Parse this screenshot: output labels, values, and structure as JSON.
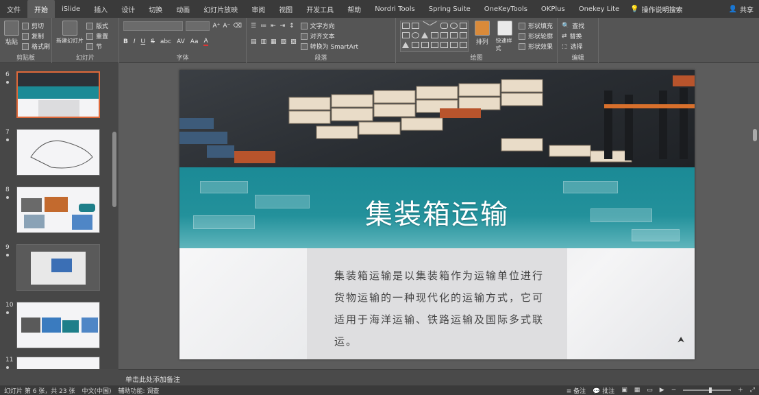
{
  "tabs": [
    "文件",
    "开始",
    "iSlide",
    "插入",
    "设计",
    "切换",
    "动画",
    "幻灯片放映",
    "审阅",
    "视图",
    "开发工具",
    "帮助",
    "Nordri Tools",
    "Spring Suite",
    "OneKeyTools",
    "OKPlus",
    "Onekey Lite"
  ],
  "active_tab_index": 1,
  "tell_me": "操作说明搜索",
  "share": "共享",
  "ribbon": {
    "clipboard": {
      "label": "剪贴板",
      "paste": "粘贴",
      "cut": "剪切",
      "copy": "复制",
      "format_painter": "格式刷"
    },
    "slides": {
      "label": "幻灯片",
      "new_slide": "新建幻灯片",
      "layout": "版式",
      "reset": "重置",
      "section": "节"
    },
    "font": {
      "label": "字体",
      "font_name": "",
      "font_size": ""
    },
    "paragraph": {
      "label": "段落",
      "text_direction": "文字方向",
      "align_text": "对齐文本",
      "smartart": "转换为 SmartArt"
    },
    "drawing": {
      "label": "绘图",
      "arrange": "排列",
      "quick_styles": "快速样式",
      "shape_fill": "形状填充",
      "shape_outline": "形状轮廓",
      "shape_effects": "形状效果"
    },
    "editing": {
      "label": "编辑",
      "find": "查找",
      "replace": "替换",
      "select": "选择"
    }
  },
  "thumbnails": [
    {
      "num": "6",
      "selected": true
    },
    {
      "num": "7",
      "selected": false
    },
    {
      "num": "8",
      "selected": false
    },
    {
      "num": "9",
      "selected": false
    },
    {
      "num": "10",
      "selected": false
    },
    {
      "num": "11",
      "selected": false
    }
  ],
  "slide": {
    "title": "集装箱运输",
    "body": "集装箱运输是以集装箱作为运输单位进行货物运输的一种现代化的运输方式，它可适用于海洋运输、铁路运输及国际多式联运。",
    "teal": "#1b8a96"
  },
  "notes_placeholder": "单击此处添加备注",
  "status": {
    "slide_info": "幻灯片 第 6 张，共 23 张",
    "language": "中文(中国)",
    "accessibility": "辅助功能: 调查",
    "notes_btn": "备注",
    "comments_btn": "批注"
  }
}
